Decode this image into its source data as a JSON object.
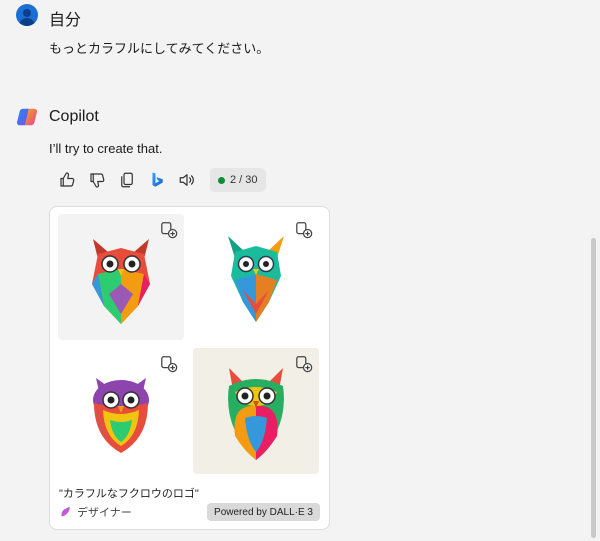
{
  "user": {
    "name": "自分",
    "message": "もっとカラフルにしてみてください。"
  },
  "copilot": {
    "name": "Copilot",
    "message": "I’ll try to create that."
  },
  "actions": {
    "counter": "2 / 30",
    "icons": [
      "thumbs-up-icon",
      "thumbs-down-icon",
      "copy-icon",
      "bing-icon",
      "speaker-icon"
    ]
  },
  "result_card": {
    "caption": "\"カラフルなフクロウのロゴ\"",
    "designer_label": "デザイナー",
    "powered_by": "Powered by DALL·E 3",
    "images": [
      {
        "background": "#f3f3f3"
      },
      {
        "background": "#ffffff"
      },
      {
        "background": "#ffffff"
      },
      {
        "background": "#f2efe6"
      }
    ]
  },
  "colors": {
    "accent": "#1d6fd6",
    "status": "#138a36",
    "page_bg": "#f3f3f3"
  }
}
